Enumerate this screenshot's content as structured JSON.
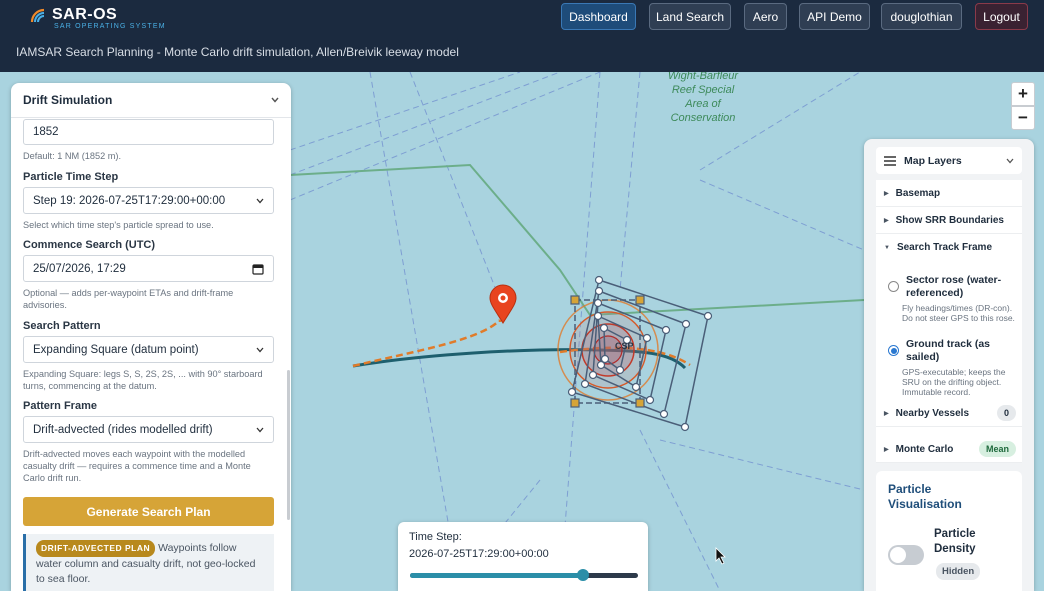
{
  "brand": {
    "title": "SAR-OS",
    "subtitle": "SAR OPERATING SYSTEM"
  },
  "page_subtitle": "IAMSAR Search Planning - Monte Carlo drift simulation, Allen/Breivik leeway model",
  "nav": [
    {
      "label": "Dashboard",
      "active": true
    },
    {
      "label": "Land Search"
    },
    {
      "label": "Aero"
    },
    {
      "label": "API Demo"
    },
    {
      "label": "douglothian"
    },
    {
      "label": "Logout"
    }
  ],
  "map": {
    "area_label": [
      "Wight-Barfleur",
      "Reef Special",
      "Area of",
      "Conservation"
    ],
    "datum_label": "CSP",
    "zoom_in": "+",
    "zoom_out": "−"
  },
  "drift_panel": {
    "title": "Drift Simulation",
    "distance_value": "1852",
    "distance_help": "Default: 1 NM (1852 m).",
    "time_step_label": "Particle Time Step",
    "time_step_value": "Step 19: 2026-07-25T17:29:00+00:00",
    "time_step_help": "Select which time step's particle spread to use.",
    "commence_label": "Commence Search (UTC)",
    "commence_value": "25/07/2026, 17:29",
    "commence_help": "Optional — adds per-waypoint ETAs and drift-frame advisories.",
    "pattern_label": "Search Pattern",
    "pattern_value": "Expanding Square (datum point)",
    "pattern_help": "Expanding Square: legs S, S, 2S, 2S, ... with 90° starboard turns, commencing at the datum.",
    "frame_label": "Pattern Frame",
    "frame_value": "Drift-advected (rides modelled drift)",
    "frame_help": "Drift-advected moves each waypoint with the modelled casualty drift — requires a commence time and a Monte Carlo drift run.",
    "generate_label": "Generate Search Plan",
    "plan_badge": "DRIFT-ADVECTED PLAN",
    "plan_text": "Waypoints follow water column and casualty drift, not geo-locked to sea floor."
  },
  "layers_panel": {
    "title": "Map Layers",
    "items": [
      {
        "label": "Basemap"
      },
      {
        "label": "Show SRR Boundaries"
      },
      {
        "label": "Search Track Frame",
        "expanded": true
      }
    ],
    "options": [
      {
        "label": "Sector rose (water-referenced)",
        "help": "Fly headings/times (DR-con). Do not steer GPS to this rose.",
        "selected": false
      },
      {
        "label": "Ground track (as sailed)",
        "help": "GPS-executable; keeps the SRU on the drifting object. Immutable record.",
        "selected": true
      }
    ],
    "nearby_vessels": {
      "label": "Nearby Vessels",
      "count": "0"
    },
    "monte_carlo": {
      "label": "Monte Carlo",
      "badge": "Mean"
    },
    "particle_vis": {
      "title": "Particle Visualisation",
      "density_label": "Particle Density",
      "density_state": "Hidden",
      "density_on": false
    }
  },
  "time_step": {
    "label": "Time Step:",
    "value": "2026-07-25T17:29:00+00:00",
    "slider_fraction": 0.76
  },
  "colors": {
    "topbar": "#1b2a3f",
    "sea": "#a9d3df",
    "accent": "#d6a437",
    "drift_orange": "#e07b2a",
    "track": "#4a5e78"
  }
}
